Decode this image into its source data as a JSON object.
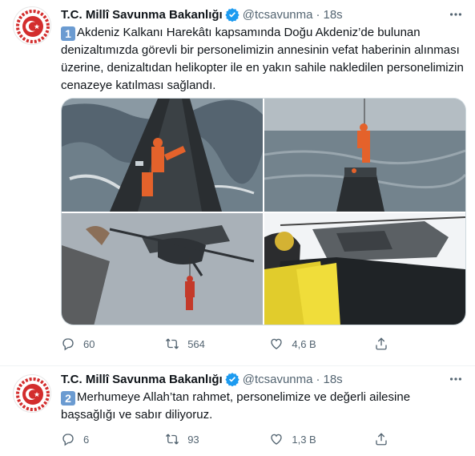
{
  "tweets": [
    {
      "account": {
        "name": "T.C. Millî Savunma Bakanlığı",
        "handle": "@tcsavunma",
        "separator": "·",
        "time": "18s",
        "avatar_icon": "msb-emblem-icon",
        "verified_icon": "verified-badge-icon"
      },
      "keycap": "1",
      "text": "Akdeniz Kalkanı Harekâtı kapsamında Doğu Akdeniz’de bulunan denizaltımızda görevli bir personelimizin annesinin vefat haberinin alınması üzerine, denizaltıdan helikopter ile en yakın sahile nakledilen personelimizin cenazeye katılması sağlandı.",
      "photos": [
        "submarine-deck-personnel-photo",
        "helicopter-hoist-over-submarine-photo",
        "helicopter-hoist-from-below-photo",
        "helicopter-crew-signal-photo"
      ],
      "metrics": {
        "replies": "60",
        "retweets": "564",
        "likes": "4,6 B"
      }
    },
    {
      "account": {
        "name": "T.C. Millî Savunma Bakanlığı",
        "handle": "@tcsavunma",
        "separator": "·",
        "time": "18s",
        "avatar_icon": "msb-emblem-icon",
        "verified_icon": "verified-badge-icon"
      },
      "keycap": "2",
      "text": "Merhumeye Allah’tan rahmet, personelimize ve değerli ailesine başsağlığı ve sabır diliyoruz.",
      "metrics": {
        "replies": "6",
        "retweets": "93",
        "likes": "1,3 B"
      }
    }
  ],
  "colors": {
    "emblem_red": "#d32d2d",
    "verified_blue": "#1d9bf0",
    "keycap_blue": "#6b9bd1",
    "muted_text": "#536471"
  }
}
